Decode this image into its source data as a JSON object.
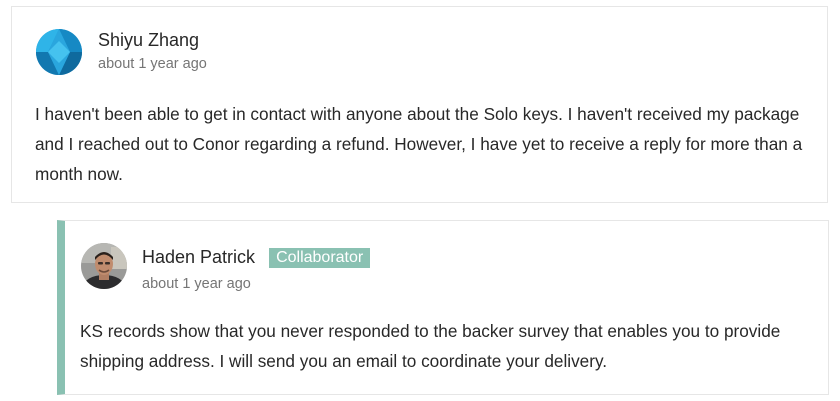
{
  "comments": [
    {
      "author": "Shiyu Zhang",
      "timestamp": "about 1 year ago",
      "avatar_icon": "blue-faceted-avatar",
      "body": "I haven't been able to get in contact with anyone about the Solo keys. I haven't received my package and I reached out to Conor regarding a refund. However, I have yet to receive a reply for more than a month now."
    }
  ],
  "reply": {
    "author": "Haden Patrick",
    "badge": "Collaborator",
    "timestamp": "about 1 year ago",
    "avatar_icon": "person-photo-avatar",
    "body": "KS records show that you never responded to the backer survey that enables you to provide shipping address. I will send you an email to coordinate your delivery."
  },
  "colors": {
    "accent": "#8ac1b2",
    "text": "#282828",
    "muted": "#757575",
    "border": "#e6e6e6"
  }
}
